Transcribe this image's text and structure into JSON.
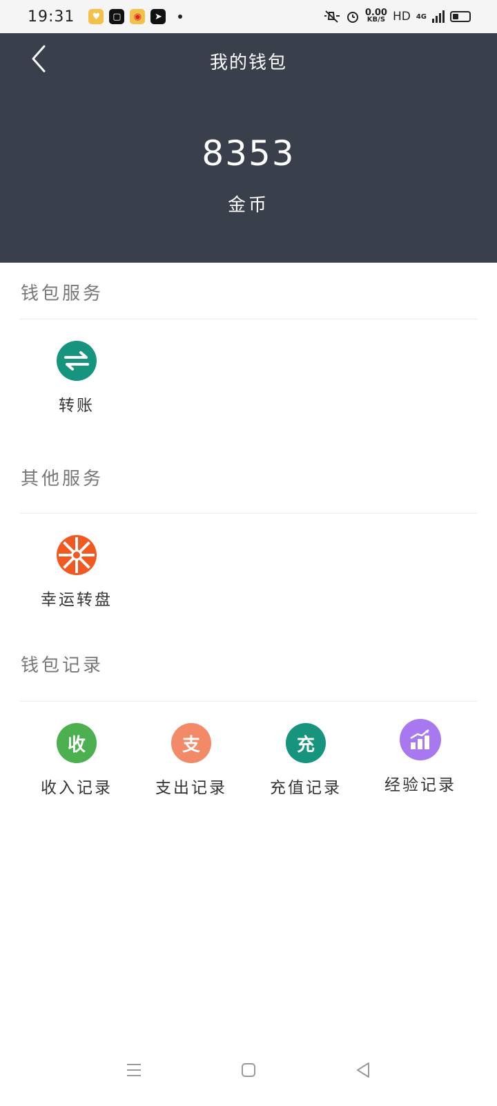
{
  "status_bar": {
    "time": "19:31",
    "net_speed_value": "0.00",
    "net_speed_unit": "KB/S",
    "hd": "HD",
    "signal": "4G"
  },
  "header": {
    "title": "我的钱包",
    "balance": "8353",
    "balance_unit": "金币",
    "bg_color": "#3a404b"
  },
  "sections": [
    {
      "title": "钱包服务",
      "items": [
        {
          "label": "转账",
          "icon": "transfer-arrows-icon",
          "color": "#16947e"
        }
      ]
    },
    {
      "title": "其他服务",
      "items": [
        {
          "label": "幸运转盘",
          "icon": "lucky-wheel-icon",
          "color": "#f05a22"
        }
      ]
    },
    {
      "title": "钱包记录",
      "items": [
        {
          "label": "收入记录",
          "icon_text": "收",
          "icon": "income-icon",
          "color": "#4caf50"
        },
        {
          "label": "支出记录",
          "icon_text": "支",
          "icon": "expense-icon",
          "color": "#f28a68"
        },
        {
          "label": "充值记录",
          "icon_text": "充",
          "icon": "recharge-icon",
          "color": "#16947e"
        },
        {
          "label": "经验记录",
          "icon": "bar-chart-icon",
          "color": "#a778f0"
        }
      ]
    }
  ],
  "nav_bar": {
    "icons": [
      "menu-icon",
      "home-square-icon",
      "back-triangle-icon"
    ]
  }
}
